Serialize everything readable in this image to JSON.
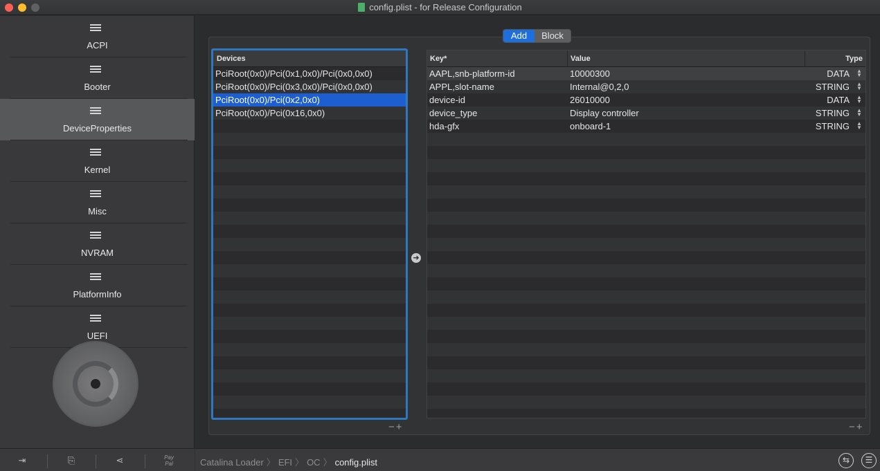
{
  "window": {
    "title": "config.plist - for Release Configuration"
  },
  "sidebar": {
    "items": [
      {
        "label": "ACPI",
        "active": false
      },
      {
        "label": "Booter",
        "active": false
      },
      {
        "label": "DeviceProperties",
        "active": true
      },
      {
        "label": "Kernel",
        "active": false
      },
      {
        "label": "Misc",
        "active": false
      },
      {
        "label": "NVRAM",
        "active": false
      },
      {
        "label": "PlatformInfo",
        "active": false
      },
      {
        "label": "UEFI",
        "active": false
      }
    ],
    "bottom": {
      "paypal_label": "Pay Pal"
    }
  },
  "segmented": {
    "add_label": "Add",
    "block_label": "Block",
    "selected": "Add"
  },
  "devices": {
    "header": "Devices",
    "rows": [
      "PciRoot(0x0)/Pci(0x1,0x0)/Pci(0x0,0x0)",
      "PciRoot(0x0)/Pci(0x3,0x0)/Pci(0x0,0x0)",
      "PciRoot(0x0)/Pci(0x2,0x0)",
      "PciRoot(0x0)/Pci(0x16,0x0)"
    ],
    "selected_index": 2,
    "minus": "−",
    "plus": "+"
  },
  "properties": {
    "headers": {
      "key": "Key*",
      "value": "Value",
      "type": "Type"
    },
    "rows": [
      {
        "key": "AAPL,snb-platform-id",
        "value": "10000300",
        "type": "DATA"
      },
      {
        "key": "APPL,slot-name",
        "value": "Internal@0,2,0",
        "type": "STRING"
      },
      {
        "key": "device-id",
        "value": "26010000",
        "type": "DATA"
      },
      {
        "key": "device_type",
        "value": "Display controller",
        "type": "STRING"
      },
      {
        "key": "hda-gfx",
        "value": "onboard-1",
        "type": "STRING"
      }
    ],
    "minus": "−",
    "plus": "+"
  },
  "pathbar": {
    "crumbs": [
      "Catalina Loader",
      "EFI",
      "OC",
      "config.plist"
    ]
  },
  "colors": {
    "accent": "#1f6ede",
    "selection": "#1d5fd1",
    "focus_ring": "#2f78c0"
  }
}
